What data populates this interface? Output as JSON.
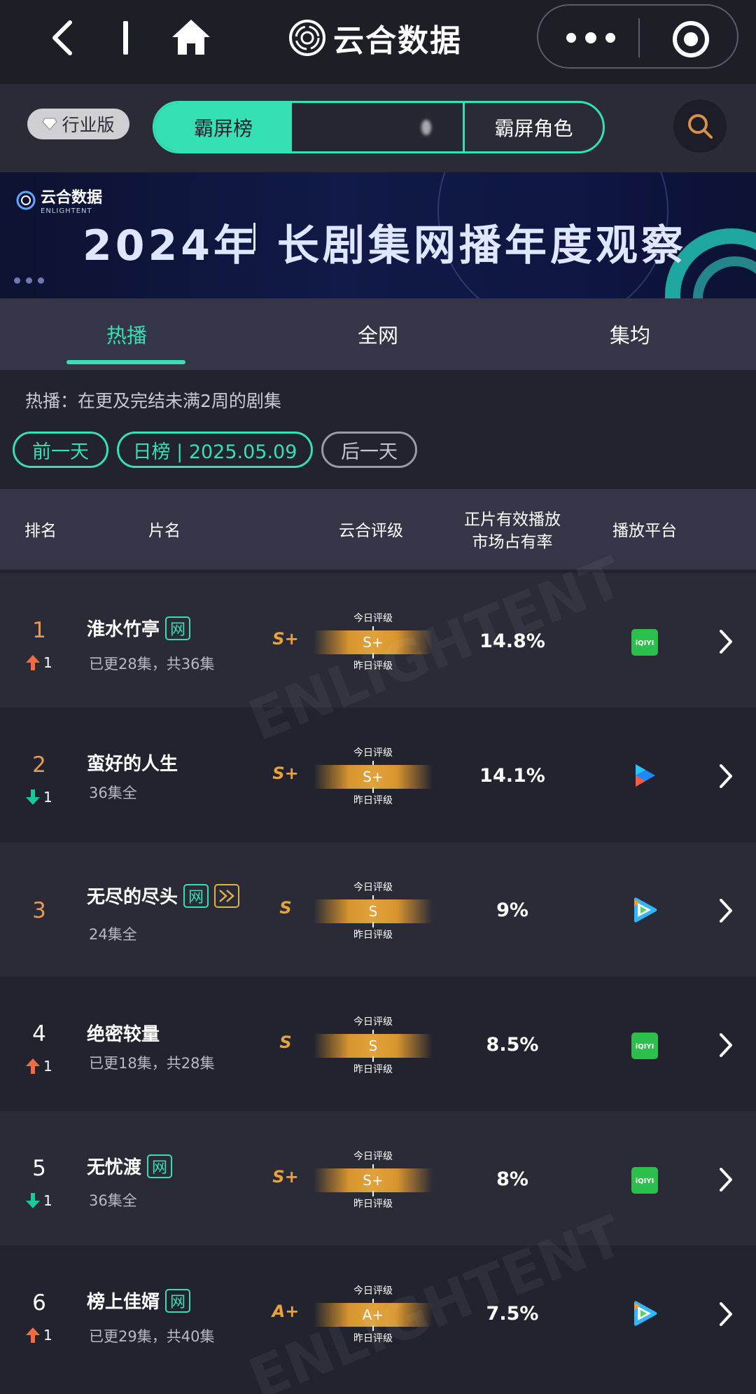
{
  "nav": {
    "title": "云合数据"
  },
  "category": {
    "industry_label": "行业版",
    "segments": [
      "霸屏榜",
      "",
      "霸屏角色"
    ]
  },
  "banner": {
    "logo_cn": "云合数据",
    "logo_en": "ENLIGHTENT",
    "title": "2024年  长剧集网播年度观察"
  },
  "tabs": [
    "热播",
    "全网",
    "集均"
  ],
  "note": "热播：在更及完结未满2周的剧集",
  "date_filter": {
    "prev": "前一天",
    "current": "日榜 | 2025.05.09",
    "next": "后一天"
  },
  "table_header": {
    "rank": "排名",
    "name": "片名",
    "rating": "云合评级",
    "share_line1": "正片有效播放",
    "share_line2": "市场占有率",
    "platform": "播放平台"
  },
  "grade_labels": {
    "today": "今日评级",
    "yesterday": "昨日评级"
  },
  "tag_net": "网",
  "rows": [
    {
      "rank": "1",
      "change": "1",
      "direction": "up",
      "title": "淮水竹亭",
      "net": true,
      "episodes": "已更28集，共36集",
      "grade": "S+",
      "share": "14.8%",
      "platform": "iqiyi-icon"
    },
    {
      "rank": "2",
      "change": "1",
      "direction": "down",
      "title": "蛮好的人生",
      "net": false,
      "episodes": "36集全",
      "grade": "S+",
      "share": "14.1%",
      "platform": "youku-icon"
    },
    {
      "rank": "3",
      "change": "",
      "direction": "none",
      "title": "无尽的尽头",
      "net": true,
      "fastforward": true,
      "episodes": "24集全",
      "grade": "S",
      "share": "9%",
      "platform": "tencent-video-icon"
    },
    {
      "rank": "4",
      "change": "1",
      "direction": "up",
      "title": "绝密较量",
      "net": false,
      "episodes": "已更18集，共28集",
      "grade": "S",
      "share": "8.5%",
      "platform": "iqiyi-icon"
    },
    {
      "rank": "5",
      "change": "1",
      "direction": "down",
      "title": "无忧渡",
      "net": true,
      "episodes": "36集全",
      "grade": "S+",
      "share": "8%",
      "platform": "iqiyi-icon"
    },
    {
      "rank": "6",
      "change": "1",
      "direction": "up",
      "title": "榜上佳婿",
      "net": true,
      "episodes": "已更29集，共40集",
      "grade": "A+",
      "share": "7.5%",
      "platform": "tencent-video-icon"
    }
  ],
  "colors": {
    "accent": "#35e0b4",
    "grade": "#e9a33b",
    "up": "#ef6c47",
    "down": "#1fc796",
    "rank_top3": "#e89a54"
  }
}
